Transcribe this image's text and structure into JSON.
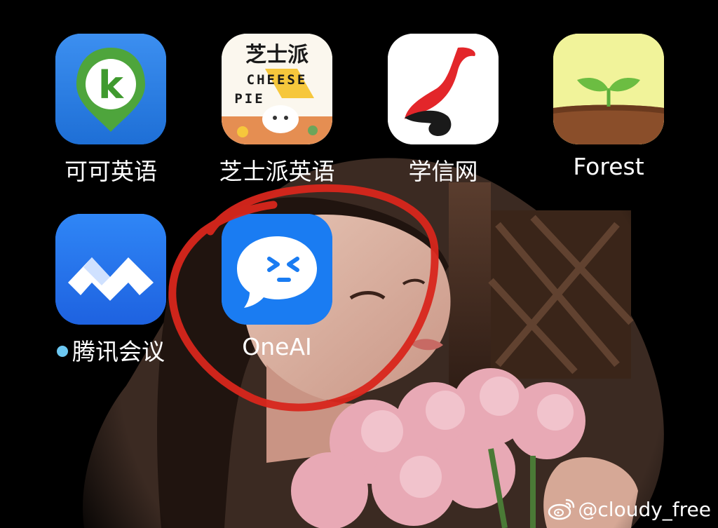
{
  "home_screen": {
    "apps": [
      {
        "label": "可可英语",
        "icon": "keke-english-icon"
      },
      {
        "label": "芝士派英语",
        "icon": "cheese-pie-english-icon",
        "icon_text": [
          "芝士派",
          "CHEESE",
          "PIE"
        ]
      },
      {
        "label": "学信网",
        "icon": "xuexin-icon"
      },
      {
        "label": "Forest",
        "icon": "forest-sapling-icon"
      },
      {
        "label": "腾讯会议",
        "icon": "tencent-meeting-icon",
        "badge": "new-dot"
      },
      {
        "label": "OneAI",
        "icon": "oneai-chat-bubble-icon",
        "highlighted": true
      }
    ]
  },
  "annotation": {
    "type": "hand-drawn circle",
    "color": "#d8261c",
    "target": "OneAI"
  },
  "watermark": {
    "text": "@cloudy_free",
    "icon": "weibo-icon"
  },
  "colors": {
    "background": "#000000",
    "keke_blue": "#2a7ee0",
    "tencent_blue": "#2a73f0",
    "oneai_blue": "#1a7cf2",
    "forest_green": "#f1f39a",
    "xuexin_red": "#e3262a"
  }
}
